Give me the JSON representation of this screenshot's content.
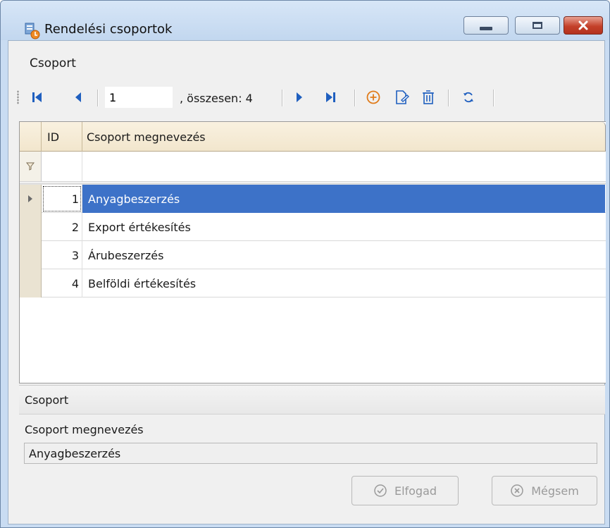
{
  "window": {
    "title": "Rendelési csoportok",
    "minimize_icon": "minimize-icon",
    "maximize_icon": "maximize-icon",
    "close_icon": "close-icon"
  },
  "group_title": "Csoport",
  "navigator": {
    "position_value": "1",
    "total_label": ", összesen: 4",
    "icons": [
      "first-record-icon",
      "prev-record-icon",
      "next-record-icon",
      "last-record-icon",
      "add-icon",
      "edit-icon",
      "delete-icon",
      "refresh-icon"
    ]
  },
  "grid": {
    "columns": [
      "ID",
      "Csoport megnevezés"
    ],
    "rows": [
      {
        "id": "1",
        "name": "Anyagbeszerzés",
        "selected": true
      },
      {
        "id": "2",
        "name": "Export értékesítés"
      },
      {
        "id": "3",
        "name": "Árubeszerzés"
      },
      {
        "id": "4",
        "name": "Belföldi értékesítés"
      }
    ]
  },
  "detail": {
    "title": "Csoport",
    "field_label": "Csoport megnevezés",
    "field_value": "Anyagbeszerzés",
    "accept_label": "Elfogad",
    "cancel_label": "Mégsem"
  },
  "colors": {
    "selection": "#3d72c8",
    "add_icon": "#e07b1a",
    "nav_icon": "#1f5fbf"
  }
}
